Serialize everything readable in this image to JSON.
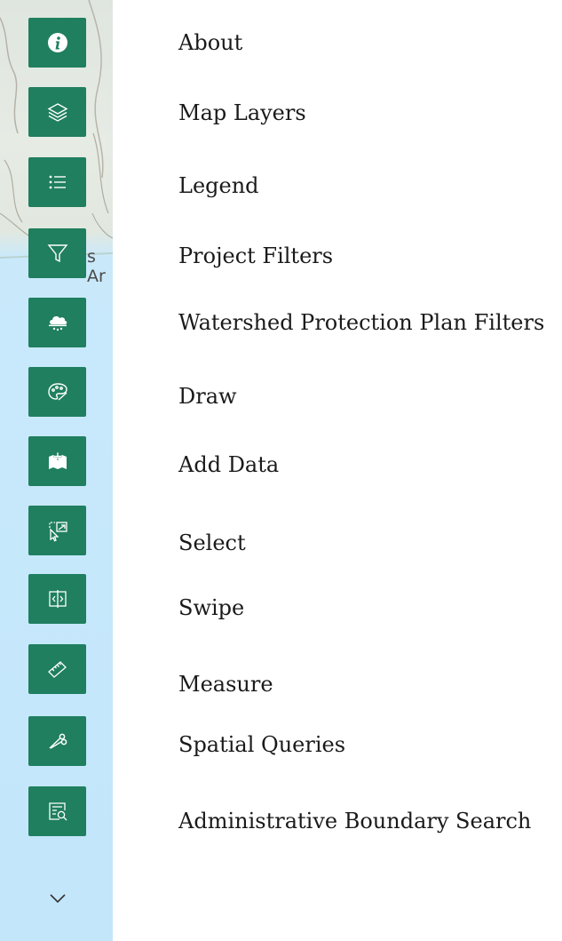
{
  "map": {
    "place_label": "s Ar"
  },
  "tools": [
    {
      "id": "about",
      "label": "About",
      "icon": "info-icon"
    },
    {
      "id": "map-layers",
      "label": "Map Layers",
      "icon": "layers-icon"
    },
    {
      "id": "legend",
      "label": "Legend",
      "icon": "list-icon"
    },
    {
      "id": "project-filters",
      "label": "Project Filters",
      "icon": "filter-icon"
    },
    {
      "id": "watershed-filters",
      "label": "Watershed Protection Plan Filters",
      "icon": "rain-cloud-icon"
    },
    {
      "id": "draw",
      "label": "Draw",
      "icon": "palette-icon"
    },
    {
      "id": "add-data",
      "label": "Add Data",
      "icon": "add-data-icon"
    },
    {
      "id": "select",
      "label": "Select",
      "icon": "select-cursor-icon"
    },
    {
      "id": "swipe",
      "label": "Swipe",
      "icon": "swipe-icon"
    },
    {
      "id": "measure",
      "label": "Measure",
      "icon": "ruler-icon"
    },
    {
      "id": "spatial-queries",
      "label": "Spatial Queries",
      "icon": "scissors-icon"
    },
    {
      "id": "admin-boundary-search",
      "label": "Administrative Boundary Search",
      "icon": "boundary-search-icon"
    }
  ],
  "more_icon": "chevron-down-icon",
  "colors": {
    "button_bg": "#1f7f5f",
    "icon_fg": "#ffffff",
    "water": "#c3e6fb",
    "land": "#e2e8e0"
  }
}
